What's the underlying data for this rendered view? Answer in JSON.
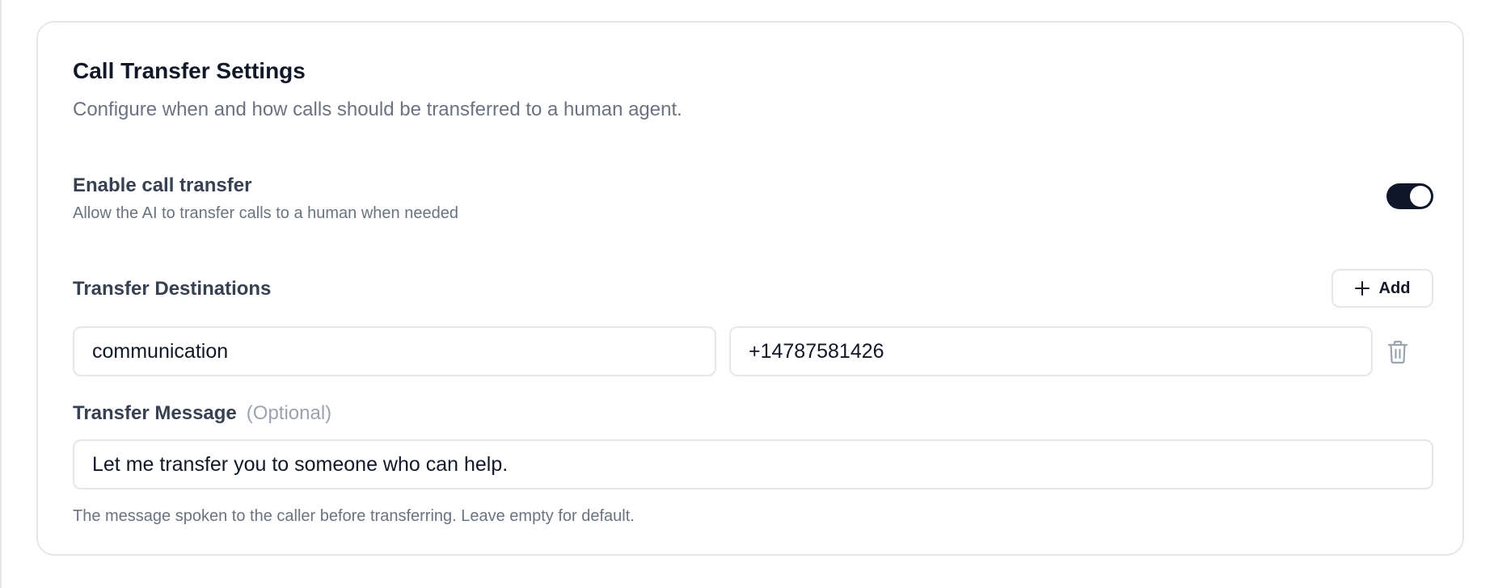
{
  "card": {
    "title": "Call Transfer Settings",
    "subtitle": "Configure when and how calls should be transferred to a human agent."
  },
  "enable_transfer": {
    "label": "Enable call transfer",
    "description": "Allow the AI to transfer calls to a human when needed",
    "enabled": true
  },
  "destinations": {
    "label": "Transfer Destinations",
    "add_label": "Add",
    "items": [
      {
        "name": "communication",
        "phone": "+14787581426"
      }
    ]
  },
  "message": {
    "label": "Transfer Message",
    "optional_tag": "(Optional)",
    "value": "Let me transfer you to someone who can help.",
    "help": "The message spoken to the caller before transferring. Leave empty for default."
  },
  "icons": {
    "add": "plus-icon",
    "delete": "trash-icon"
  },
  "colors": {
    "toggle_on": "#0f172a",
    "border": "#e5e7eb",
    "muted_text": "#6b7280",
    "optional_text": "#9ca3af"
  }
}
